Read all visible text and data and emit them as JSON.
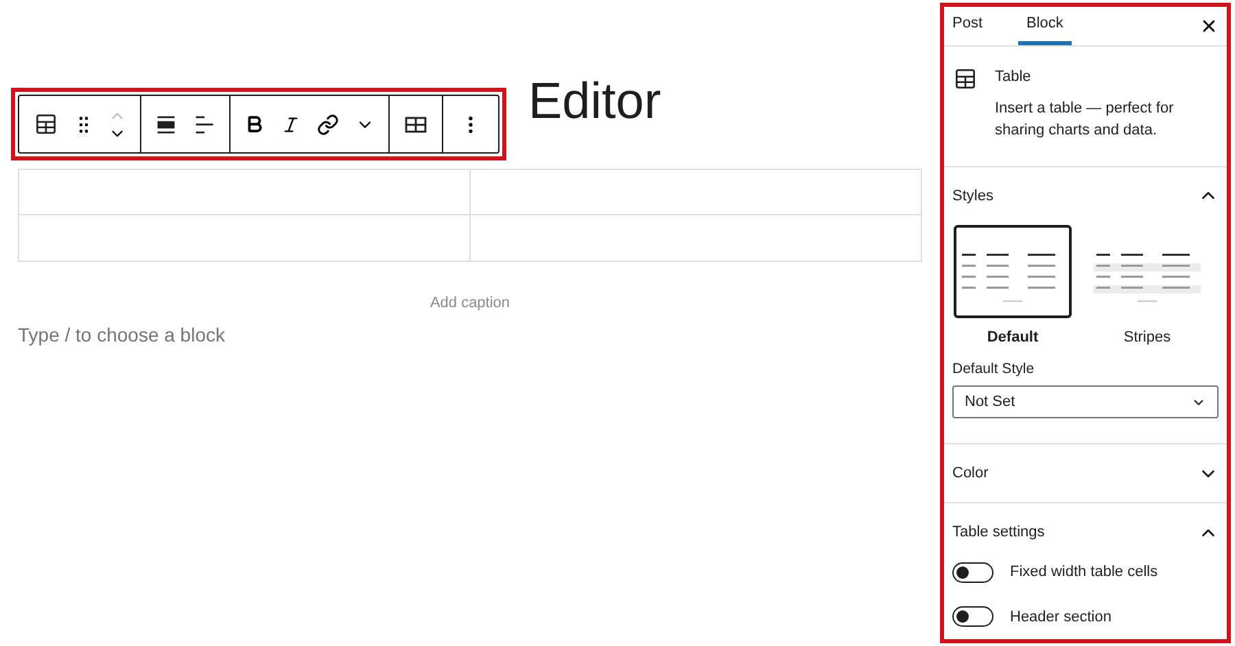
{
  "editor": {
    "title": "Editor",
    "caption_placeholder": "Add caption",
    "block_placeholder": "Type / to choose a block"
  },
  "sidebar": {
    "tabs": [
      {
        "label": "Post",
        "selected": false
      },
      {
        "label": "Block",
        "selected": true
      }
    ],
    "block": {
      "name": "Table",
      "description": "Insert a table — perfect for sharing charts and data."
    },
    "panels": [
      {
        "kind": "styles",
        "title": "Styles",
        "expanded": true,
        "options": [
          {
            "kind": "default",
            "label": "Default",
            "selected": true
          },
          {
            "kind": "stripes",
            "label": "Stripes",
            "selected": false
          }
        ],
        "default_style": {
          "label": "Default Style",
          "value": "Not Set"
        }
      },
      {
        "kind": "color",
        "title": "Color",
        "expanded": false
      },
      {
        "kind": "table-settings",
        "title": "Table settings",
        "expanded": true,
        "toggles": [
          {
            "label": "Fixed width table cells",
            "on": false
          },
          {
            "label": "Header section",
            "on": false
          }
        ]
      }
    ]
  }
}
